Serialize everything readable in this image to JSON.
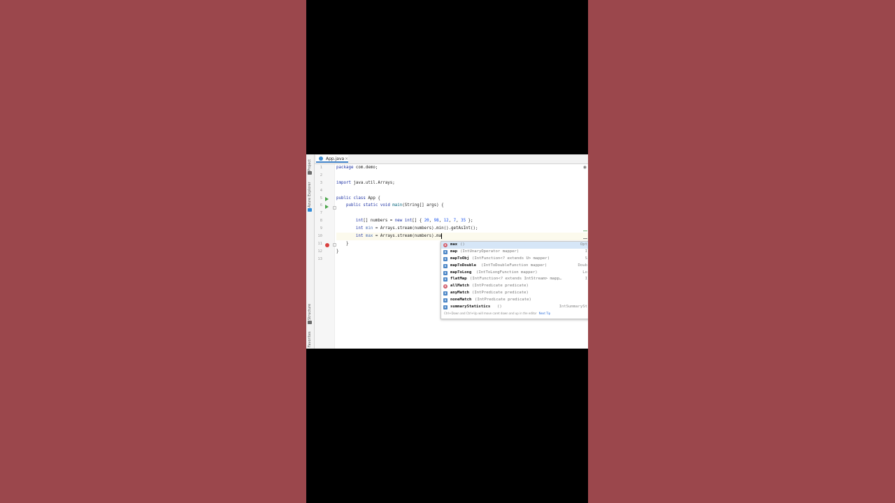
{
  "editor": {
    "tab": {
      "title": "App.java",
      "close": "×"
    },
    "tool_windows": [
      "Project",
      "Azure Explorer",
      "Structure",
      "Favorites"
    ],
    "line_numbers": [
      "1",
      "2",
      "3",
      "4",
      "5",
      "6",
      "7",
      "8",
      "9",
      "10",
      "11",
      "12",
      "13"
    ],
    "code": {
      "l1": {
        "kw": "package",
        "rest": " com.demo;"
      },
      "l3": {
        "kw": "import",
        "rest": " java.util.Arrays;"
      },
      "l5": {
        "kw1": "public",
        "kw2": " class",
        "rest": " App {"
      },
      "l6": {
        "indent": "    ",
        "kw1": "public",
        "kw2": " static",
        "kw3": " void",
        "fn": " main",
        "rest": "(String[] args) {"
      },
      "l8": {
        "indent": "        ",
        "kw": "int",
        "rest1": "[] numbers = ",
        "kw2": "new",
        "kw3": " int",
        "rest2": "[] { ",
        "n1": "20",
        "sep1": ", ",
        "n2": "98",
        "sep2": ", ",
        "n3": "12",
        "sep3": ", ",
        "n4": "7",
        "sep4": ", ",
        "n5": "35",
        "rest3": " };"
      },
      "l9": {
        "indent": "        ",
        "kw": "int",
        "var": " min",
        "rest": " = Arrays.stream(numbers).min().getAsInt();"
      },
      "l10": {
        "indent": "        ",
        "kw": "int",
        "var": " max",
        "rest": " = Arrays.stream(numbers).ma"
      },
      "l11": {
        "indent": "    ",
        "rest": "}"
      },
      "l12": {
        "rest": "}"
      }
    }
  },
  "completion": {
    "items": [
      {
        "name": "max",
        "sig": "()",
        "type": "Opt"
      },
      {
        "name": "map",
        "sig": "(IntUnaryOperator mapper)",
        "type": "I"
      },
      {
        "name": "mapToObj",
        "sig": "(IntFunction<? extends U> mapper)",
        "type": "S"
      },
      {
        "name": "mapToDouble",
        "sig": "(IntToDoubleFunction mapper)",
        "type": "Doub"
      },
      {
        "name": "mapToLong",
        "sig": "(IntToLongFunction mapper)",
        "type": "Lo"
      },
      {
        "name": "flatMap",
        "sig": "(IntFunction<? extends IntStream> mapp…",
        "type": "I"
      },
      {
        "name": "allMatch",
        "sig": "(IntPredicate predicate)",
        "type": ""
      },
      {
        "name": "anyMatch",
        "sig": "(IntPredicate predicate)",
        "type": ""
      },
      {
        "name": "noneMatch",
        "sig": "(IntPredicate predicate)",
        "type": ""
      },
      {
        "name": "summaryStatistics",
        "sig": "()",
        "type": "IntSummarySt"
      }
    ],
    "hint": "Ctrl+Down and Ctrl+Up will move caret down and up in the editor",
    "hint_link": "Next Tip"
  },
  "colors": {
    "background": "#9b474c",
    "keyword": "#1a2fa3",
    "number": "#1750eb",
    "selection": "#d6e6f7"
  }
}
